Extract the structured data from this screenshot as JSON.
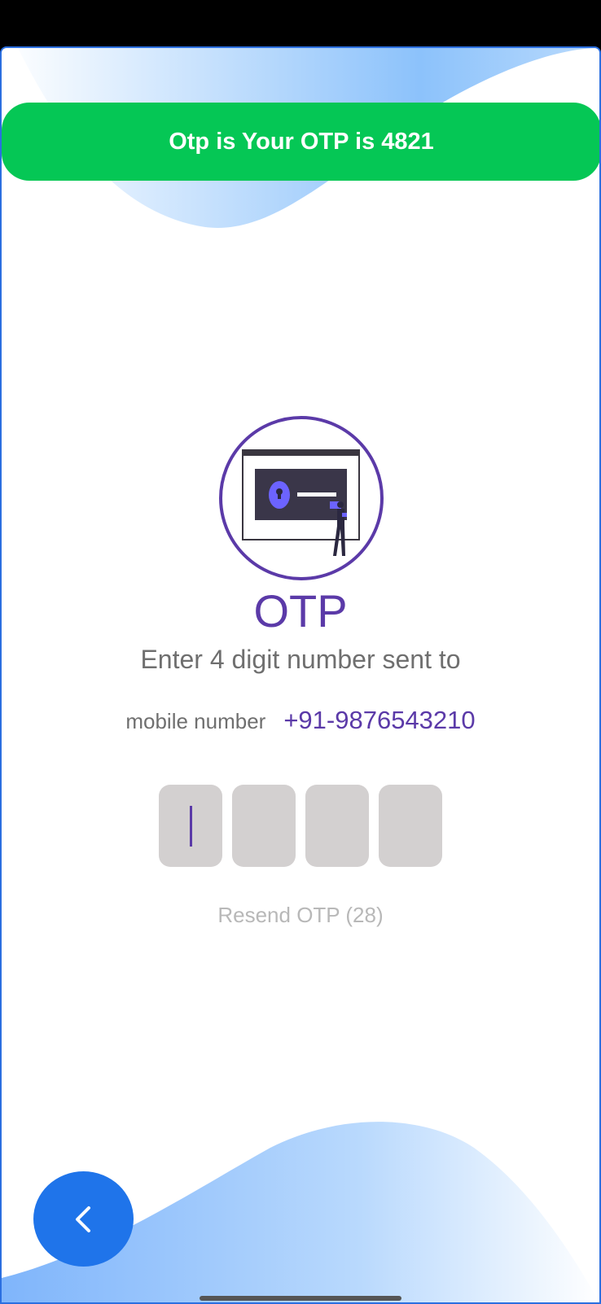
{
  "toast": {
    "message": "Otp is Your OTP is 4821"
  },
  "otp": {
    "title": "OTP",
    "instruction": "Enter 4 digit number sent to",
    "mobile_label": "mobile number",
    "mobile_number": "+91-9876543210",
    "digits": [
      "",
      "",
      "",
      ""
    ],
    "resend_label": "Resend OTP (28)"
  },
  "icons": {
    "back": "chevron-left-icon",
    "illustration": "lock-screen-illustration"
  },
  "colors": {
    "accent": "#5b3aa8",
    "toast_bg": "#05c755",
    "back_button": "#1f74ea",
    "otp_box": "#d3d0d0",
    "frame_border": "#2b6fe0"
  }
}
